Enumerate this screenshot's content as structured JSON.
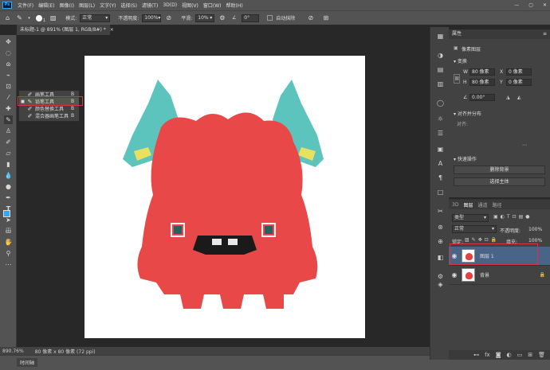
{
  "menubar": {
    "items": [
      "文件(F)",
      "编辑(E)",
      "图像(I)",
      "图层(L)",
      "文字(Y)",
      "选择(S)",
      "滤镜(T)",
      "3D(D)",
      "视图(V)",
      "窗口(W)",
      "帮助(H)"
    ]
  },
  "window_controls": {
    "minimize": "—",
    "maximize": "▢",
    "close": "✕"
  },
  "options": {
    "brush_size": "1",
    "mode_label": "模式:",
    "mode_value": "正常",
    "opacity_label": "不透明度:",
    "opacity_value": "100%",
    "flow_label": "平滑:",
    "flow_value": "10%",
    "angle": "0°",
    "auto_erase": "自动抹除"
  },
  "document": {
    "tab_title": "未标题-1 @ 891% (图层 1, RGB/8#) *",
    "close": "×"
  },
  "flyout": {
    "items": [
      {
        "label": "画笔工具",
        "key": "B"
      },
      {
        "label": "铅笔工具",
        "key": "B"
      },
      {
        "label": "颜色替换工具",
        "key": "B"
      },
      {
        "label": "混合器画笔工具",
        "key": "B"
      }
    ]
  },
  "status": {
    "zoom": "890.76%",
    "size": "80 像素 x 80 像素 (72 ppi)"
  },
  "timeline": {
    "label": "时间轴"
  },
  "properties": {
    "title": "属性",
    "kind": "像素图层",
    "transform_label": "变换",
    "w_label": "W",
    "w": "80 像素",
    "x_label": "X",
    "x": "0 像素",
    "h_label": "H",
    "h": "80 像素",
    "y_label": "Y",
    "y": "0 像素",
    "angle": "0.00°",
    "align_label": "对齐并分布",
    "align_sub": "对齐:",
    "quick_label": "快速操作",
    "remove_bg": "删除背景",
    "select_subject": "选择主体"
  },
  "layers": {
    "tabs": [
      "3D",
      "图层",
      "通道",
      "路径"
    ],
    "filter": "类型",
    "blend": "正常",
    "opacity_label": "不透明度:",
    "opacity": "100%",
    "lock_label": "锁定:",
    "fill_label": "填充:",
    "fill": "100%",
    "items": [
      {
        "name": "图层 1"
      },
      {
        "name": "背景"
      }
    ]
  },
  "colors": {
    "accent": "#31a8ff",
    "highlight": "#e0303a",
    "monster": "#e84848",
    "horn": "#5cc4bd"
  }
}
